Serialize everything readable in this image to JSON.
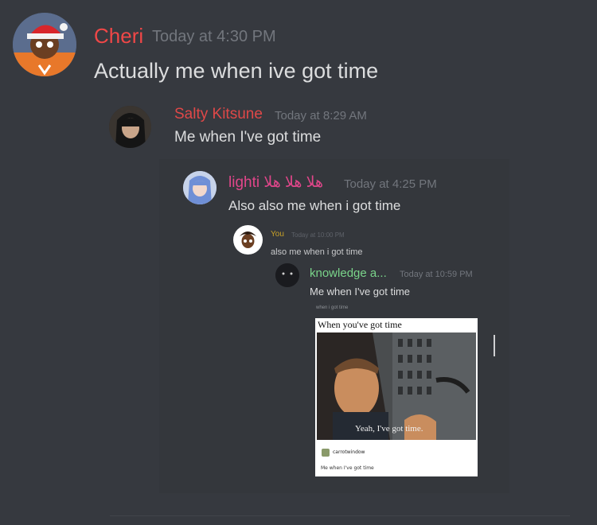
{
  "colors": {
    "background": "#36393f",
    "time": "#72767d",
    "text": "#dcddde",
    "cheri": "#f04747",
    "salty": "#e04848",
    "lighti": "#e0468a",
    "you": "#c9a227",
    "knowledge": "#7ad48a"
  },
  "message": {
    "author": "Cheri",
    "time": "Today at 4:30 PM",
    "text": "Actually me when ive got time"
  },
  "quote1": {
    "author": "Salty Kitsune",
    "time": "Today at 8:29 AM",
    "text": "Me when I've got time"
  },
  "quote2": {
    "author": "lighti هلا هلا هلا",
    "time": "Today at 4:25 PM",
    "text": "Also also me when i got time"
  },
  "quote3": {
    "author": "You",
    "time": "Today at 10:00 PM",
    "text": "also me when i got time"
  },
  "quote4": {
    "author": "knowledge a...",
    "time": "Today at 10:59 PM",
    "text": "Me when I've got time",
    "subtext": "when i got time"
  },
  "meme": {
    "caption": "When you've got time",
    "subtitle": "Yeah, I've got time.",
    "footer_user": "carrotwindow",
    "footer_text": "Me when I've got time"
  },
  "icons": [
    "cheri-avatar",
    "salty-kitsune-avatar",
    "lighti-avatar",
    "you-avatar",
    "knowledge-avatar",
    "carrotwindow-avatar"
  ]
}
